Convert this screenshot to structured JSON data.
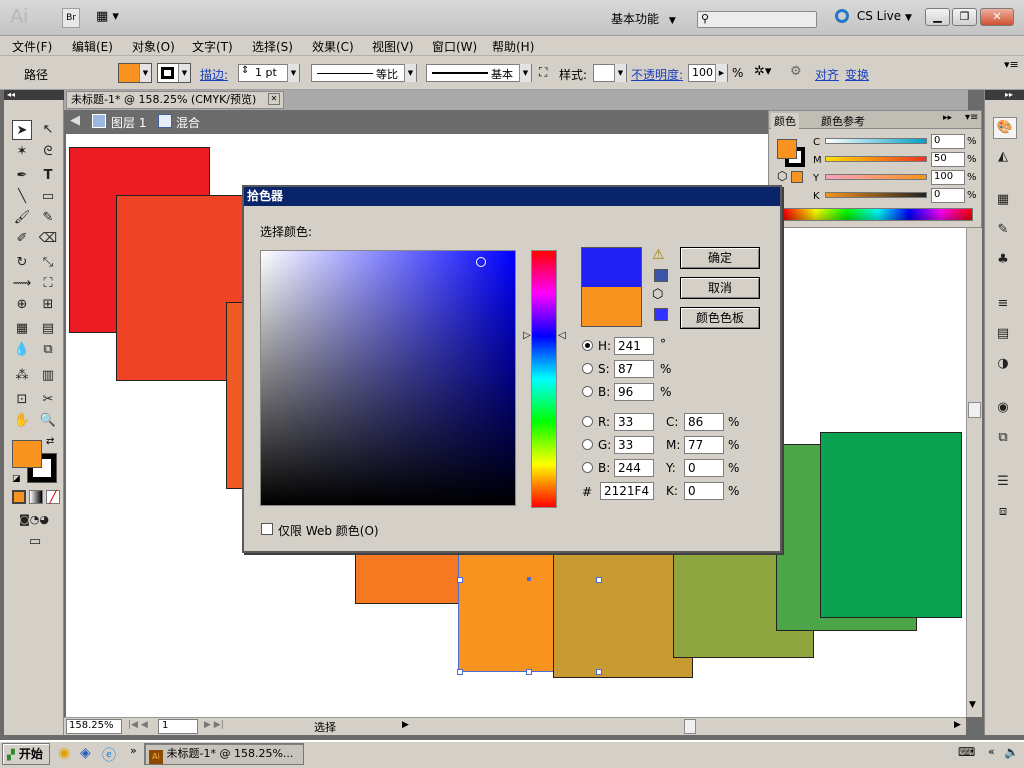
{
  "app": {
    "logo": "Ai",
    "bridge": "Br",
    "workspace_label": "基本功能",
    "cslive_label": "CS Live"
  },
  "menu": [
    "文件(F)",
    "编辑(E)",
    "对象(O)",
    "文字(T)",
    "选择(S)",
    "效果(C)",
    "视图(V)",
    "窗口(W)",
    "帮助(H)"
  ],
  "control": {
    "object_type": "路径",
    "stroke_label": "描边:",
    "stroke_weight": "1 pt",
    "profile_label": "等比",
    "brush_label": "基本",
    "style_label": "样式:",
    "opacity_label": "不透明度:",
    "opacity_value": "100",
    "opacity_unit": "%",
    "align_label": "对齐",
    "transform_label": "变换"
  },
  "document": {
    "tab_title": "未标题-1* @ 158.25% (CMYK/预览)",
    "layer_label": "图层 1",
    "blend_label": "混合",
    "zoom": "158.25%",
    "page": "1",
    "status": "选择"
  },
  "color_panel": {
    "tab_color": "颜色",
    "tab_guide": "颜色参考",
    "channels": [
      {
        "label": "C",
        "value": "0",
        "unit": "%"
      },
      {
        "label": "M",
        "value": "50",
        "unit": "%"
      },
      {
        "label": "Y",
        "value": "100",
        "unit": "%"
      },
      {
        "label": "K",
        "value": "0",
        "unit": "%"
      }
    ]
  },
  "picker": {
    "title": "拾色器",
    "select_label": "选择颜色:",
    "ok_label": "确定",
    "cancel_label": "取消",
    "swatches_label": "颜色色板",
    "web_only_label": "仅限 Web 颜色(O)",
    "H": {
      "label": "H:",
      "value": "241",
      "unit": "°"
    },
    "S": {
      "label": "S:",
      "value": "87",
      "unit": "%"
    },
    "Bv": {
      "label": "B:",
      "value": "96",
      "unit": "%"
    },
    "R": {
      "label": "R:",
      "value": "33"
    },
    "G": {
      "label": "G:",
      "value": "33"
    },
    "Bb": {
      "label": "B:",
      "value": "244"
    },
    "C": {
      "label": "C:",
      "value": "86",
      "unit": "%"
    },
    "M": {
      "label": "M:",
      "value": "77",
      "unit": "%"
    },
    "Y": {
      "label": "Y:",
      "value": "0",
      "unit": "%"
    },
    "K": {
      "label": "K:",
      "value": "0",
      "unit": "%"
    },
    "hex_label": "#",
    "hex_value": "2121F4",
    "new_color": "#2121f4",
    "old_color": "#f7931e"
  },
  "taskbar": {
    "start_label": "开始",
    "task_label": "未标题-1* @ 158.25%..."
  },
  "colors": {
    "fill": "#f7931e",
    "accent": "#0a246a"
  }
}
